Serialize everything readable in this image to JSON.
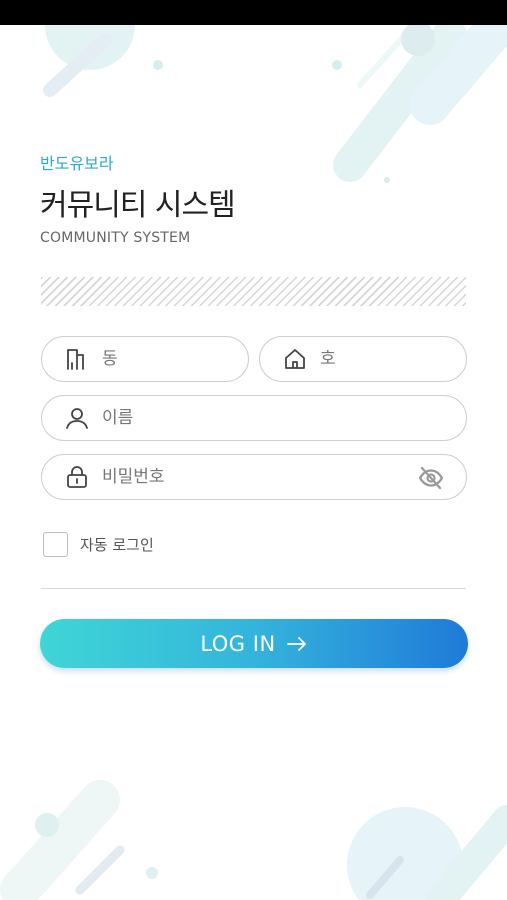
{
  "brand": "반도유보라",
  "title": "커뮤니티 시스템",
  "subtitle": "COMMUNITY SYSTEM",
  "form": {
    "dong_placeholder": "동",
    "ho_placeholder": "호",
    "name_placeholder": "이름",
    "password_placeholder": "비밀번호",
    "remember_label": "자동 로그인",
    "login_label": "LOG IN"
  },
  "icons": {
    "dong": "building-icon",
    "ho": "house-icon",
    "name": "user-icon",
    "password": "lock-icon",
    "toggle": "eye-off-icon",
    "login": "arrow-right-icon"
  },
  "colors": {
    "brand": "#2aa8d9",
    "button_start": "#3fd6d6",
    "button_end": "#1f7ad8"
  }
}
